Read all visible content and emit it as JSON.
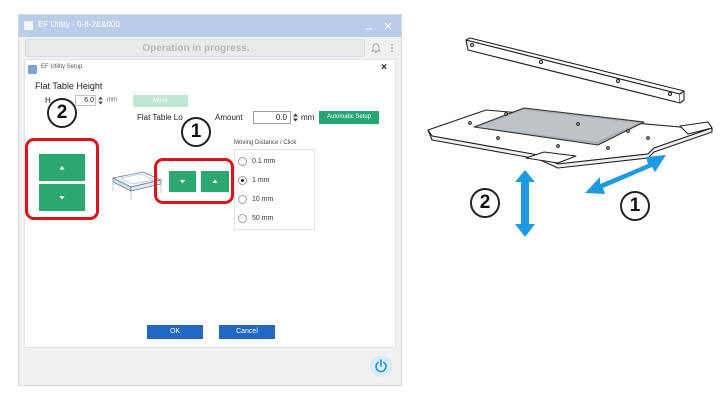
{
  "app": {
    "title": "EF Utility - 0-8-2&&000",
    "status": "Operation in progress."
  },
  "dialog": {
    "title": "EF Utility  Setup",
    "close_glyph": "×",
    "section_title": "Flat Table Height",
    "height_label": "H",
    "height_value": "6.0",
    "height_unit": "mm",
    "move_label": "Move",
    "lower_label": "Flat Table Lo",
    "amount_label": "Amount",
    "amount_value": "0.0",
    "amount_unit": "mm",
    "auto_setup_label": "Automatic Setup",
    "moving_distance": {
      "title": "Moving Distance / Click",
      "options": [
        "0.1 mm",
        "1 mm",
        "10 mm",
        "50 mm"
      ],
      "selected": "1 mm"
    },
    "ok_label": "OK",
    "cancel_label": "Cancel"
  },
  "callouts": {
    "z_axis": "2",
    "xy_axis": "1"
  },
  "illustration": {
    "label_2": "2",
    "label_1": "1"
  },
  "colors": {
    "accent_green": "#2ba86f",
    "button_blue": "#2068c4",
    "callout_red": "#d9141b",
    "arrow_blue": "#1e9be0",
    "titlebar": "#b9cde8"
  },
  "icons": {
    "window_min": "minimize-icon",
    "window_close": "close-icon",
    "bell": "bell-icon",
    "menu": "kebab-menu-icon",
    "power": "power-icon"
  }
}
